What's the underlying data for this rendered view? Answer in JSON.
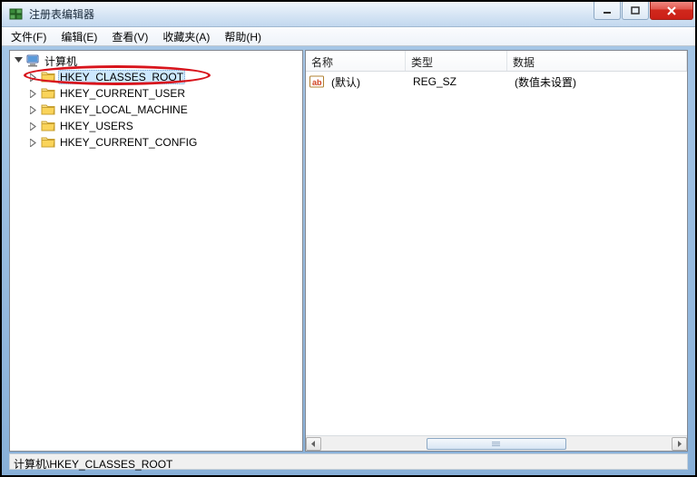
{
  "titlebar": {
    "title": "注册表编辑器"
  },
  "menu": {
    "file": "文件(F)",
    "edit": "编辑(E)",
    "view": "查看(V)",
    "favorites": "收藏夹(A)",
    "help": "帮助(H)"
  },
  "tree": {
    "root": "计算机",
    "items": [
      {
        "label": "HKEY_CLASSES_ROOT",
        "selected": true
      },
      {
        "label": "HKEY_CURRENT_USER",
        "selected": false
      },
      {
        "label": "HKEY_LOCAL_MACHINE",
        "selected": false
      },
      {
        "label": "HKEY_USERS",
        "selected": false
      },
      {
        "label": "HKEY_CURRENT_CONFIG",
        "selected": false
      }
    ]
  },
  "list": {
    "columns": {
      "name": "名称",
      "type": "类型",
      "data": "数据"
    },
    "rows": [
      {
        "name": "(默认)",
        "type": "REG_SZ",
        "data": "(数值未设置)"
      }
    ]
  },
  "statusbar": {
    "path": "计算机\\HKEY_CLASSES_ROOT"
  },
  "colors": {
    "highlight": "#d8141c"
  }
}
